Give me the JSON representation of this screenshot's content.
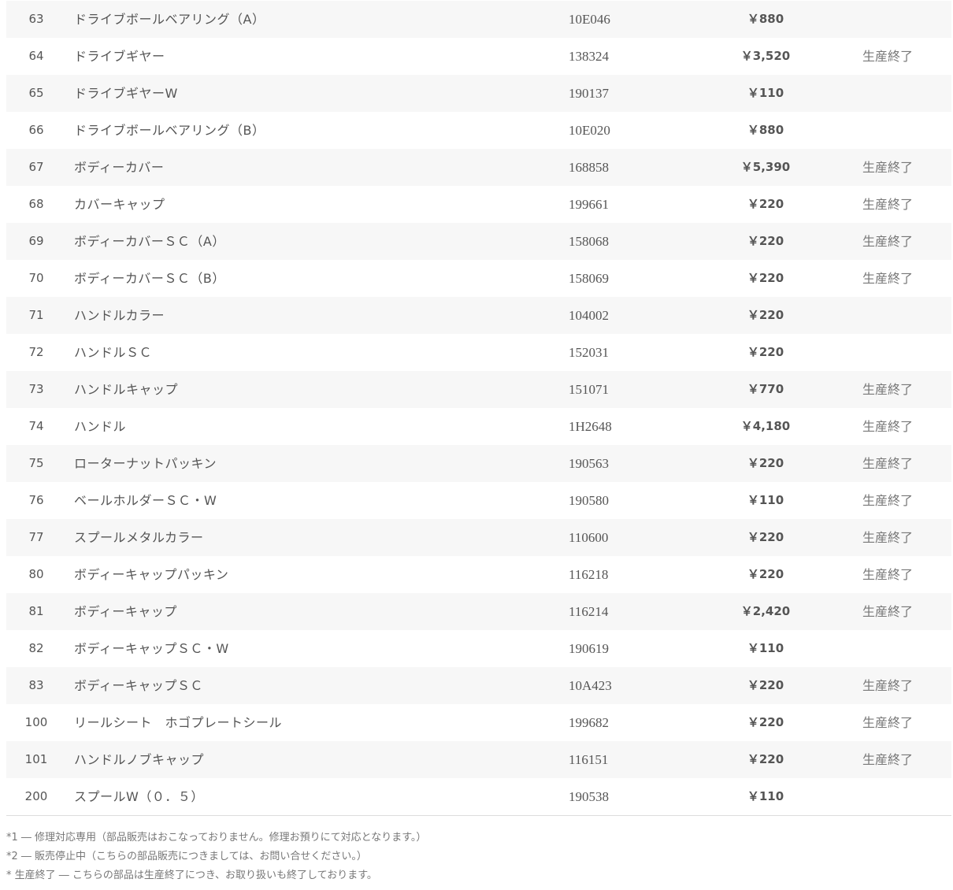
{
  "parts": [
    {
      "no": "63",
      "name": "ドライブボールベアリング（A）",
      "code": "10E046",
      "price": "￥880",
      "status": ""
    },
    {
      "no": "64",
      "name": "ドライブギヤー",
      "code": "138324",
      "price": "￥3,520",
      "status": "生産終了"
    },
    {
      "no": "65",
      "name": "ドライブギヤーW",
      "code": "190137",
      "price": "￥110",
      "status": ""
    },
    {
      "no": "66",
      "name": "ドライブボールベアリング（B）",
      "code": "10E020",
      "price": "￥880",
      "status": ""
    },
    {
      "no": "67",
      "name": "ボディーカバー",
      "code": "168858",
      "price": "￥5,390",
      "status": "生産終了"
    },
    {
      "no": "68",
      "name": "カバーキャップ",
      "code": "199661",
      "price": "￥220",
      "status": "生産終了"
    },
    {
      "no": "69",
      "name": "ボディーカバーＳＣ（A）",
      "code": "158068",
      "price": "￥220",
      "status": "生産終了"
    },
    {
      "no": "70",
      "name": "ボディーカバーＳＣ（B）",
      "code": "158069",
      "price": "￥220",
      "status": "生産終了"
    },
    {
      "no": "71",
      "name": "ハンドルカラー",
      "code": "104002",
      "price": "￥220",
      "status": ""
    },
    {
      "no": "72",
      "name": "ハンドルＳＣ",
      "code": "152031",
      "price": "￥220",
      "status": ""
    },
    {
      "no": "73",
      "name": "ハンドルキャップ",
      "code": "151071",
      "price": "￥770",
      "status": "生産終了"
    },
    {
      "no": "74",
      "name": "ハンドル",
      "code": "1H2648",
      "price": "￥4,180",
      "status": "生産終了"
    },
    {
      "no": "75",
      "name": "ローターナットパッキン",
      "code": "190563",
      "price": "￥220",
      "status": "生産終了"
    },
    {
      "no": "76",
      "name": "ベールホルダーＳＣ・W",
      "code": "190580",
      "price": "￥110",
      "status": "生産終了"
    },
    {
      "no": "77",
      "name": "スプールメタルカラー",
      "code": "110600",
      "price": "￥220",
      "status": "生産終了"
    },
    {
      "no": "80",
      "name": "ボディーキャップパッキン",
      "code": "116218",
      "price": "￥220",
      "status": "生産終了"
    },
    {
      "no": "81",
      "name": "ボディーキャップ",
      "code": "116214",
      "price": "￥2,420",
      "status": "生産終了"
    },
    {
      "no": "82",
      "name": "ボディーキャップＳＣ・W",
      "code": "190619",
      "price": "￥110",
      "status": ""
    },
    {
      "no": "83",
      "name": "ボディーキャップＳＣ",
      "code": "10A423",
      "price": "￥220",
      "status": "生産終了"
    },
    {
      "no": "100",
      "name": "リールシート　ホゴプレートシール",
      "code": "199682",
      "price": "￥220",
      "status": "生産終了"
    },
    {
      "no": "101",
      "name": "ハンドルノブキャップ",
      "code": "116151",
      "price": "￥220",
      "status": "生産終了"
    },
    {
      "no": "200",
      "name": "スプールW（０．５）",
      "code": "190538",
      "price": "￥110",
      "status": ""
    }
  ],
  "notes": [
    "*1 ― 修理対応専用（部品販売はおこなっておりません。修理お預りにて対応となります。）",
    "*2 ― 販売停止中（こちらの部品販売につきましては、お問い合せください。）",
    "* 生産終了 ― こちらの部品は生産終了につき、お取り扱いも終了しております。"
  ]
}
